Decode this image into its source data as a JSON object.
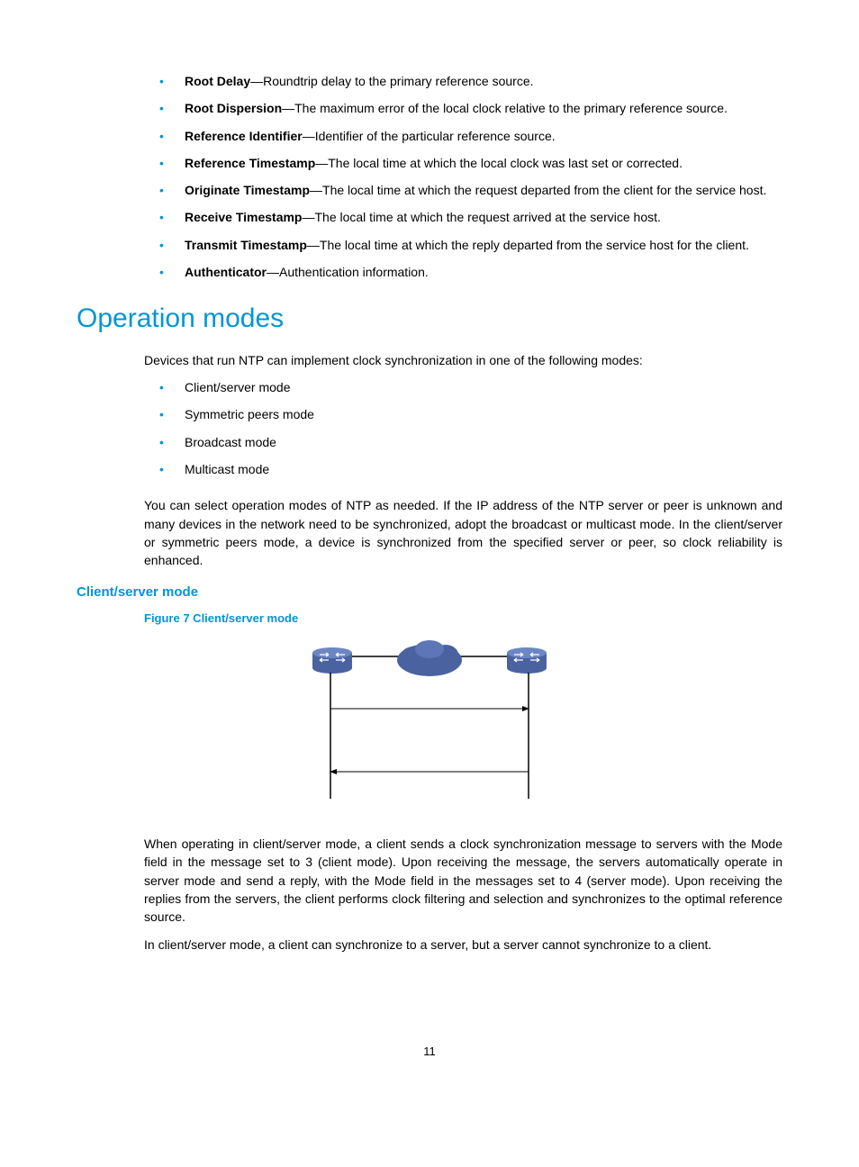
{
  "definitions": [
    {
      "term": "Root Delay",
      "desc": "—Roundtrip delay to the primary reference source."
    },
    {
      "term": "Root Dispersion",
      "desc": "—The maximum error of the local clock relative to the primary reference source."
    },
    {
      "term": "Reference Identifier",
      "desc": "—Identifier of the particular reference source."
    },
    {
      "term": "Reference Timestamp",
      "desc": "—The local time at which the local clock was last set or corrected."
    },
    {
      "term": "Originate Timestamp",
      "desc": "—The local time at which the request departed from the client for the service host."
    },
    {
      "term": "Receive Timestamp",
      "desc": "—The local time at which the request arrived at the service host."
    },
    {
      "term": "Transmit Timestamp",
      "desc": "—The local time at which the reply departed from the service host for the client."
    },
    {
      "term": "Authenticator",
      "desc": "—Authentication information."
    }
  ],
  "operation_modes": {
    "heading": "Operation modes",
    "intro": "Devices that run NTP can implement clock synchronization in one of the following modes:",
    "modes": [
      "Client/server mode",
      "Symmetric peers mode",
      "Broadcast mode",
      "Multicast mode"
    ],
    "note": "You can select operation modes of NTP as needed. If the IP address of the NTP server or peer is unknown and many devices in the network need to be synchronized, adopt the broadcast or multicast mode. In the client/server or symmetric peers mode, a device is synchronized from the specified server or peer, so clock reliability is enhanced."
  },
  "client_server": {
    "heading": "Client/server mode",
    "figure_caption": "Figure 7 Client/server mode",
    "para1": "When operating in client/server mode, a client sends a clock synchronization message to servers with the Mode field in the message set to 3 (client mode). Upon receiving the message, the servers automatically operate in server mode and send a reply, with the Mode field in the messages set to 4 (server mode). Upon receiving the replies from the servers, the client performs clock filtering and selection and synchronizes to the optimal reference source.",
    "para2": "In client/server mode, a client can synchronize to a server, but a server cannot synchronize to a client."
  },
  "page_number": "11"
}
